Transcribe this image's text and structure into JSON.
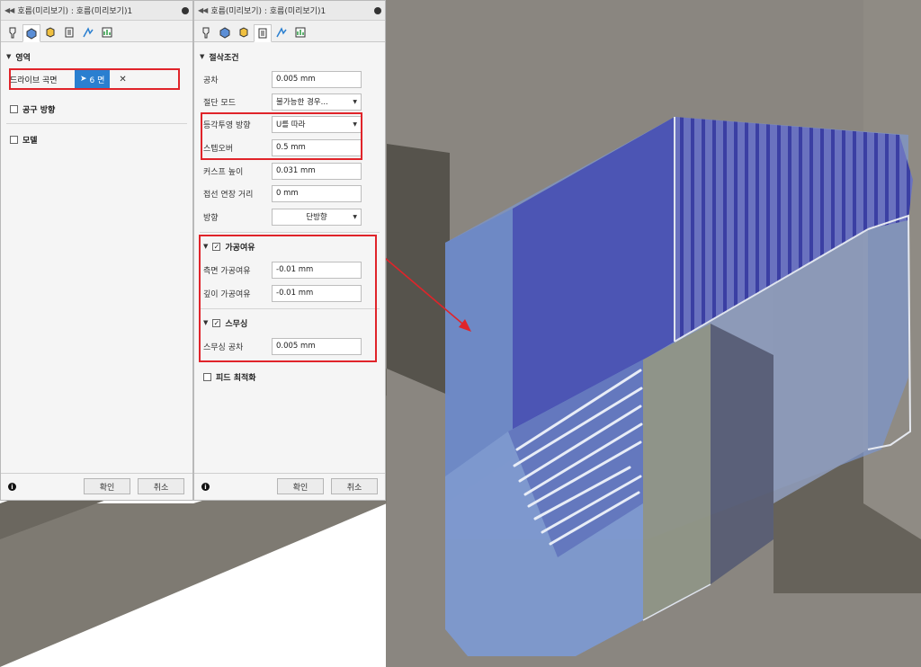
{
  "panel_left": {
    "title": "호름(미리보기) : 호름(미리보기)1",
    "section_region": "영역",
    "drive_surface_label": "드라이브 곡면",
    "face_count": "6 면",
    "clear_glyph": "✕",
    "tool_direction": "공구 방향",
    "model": "모델",
    "ok": "확인",
    "cancel": "취소"
  },
  "panel_right": {
    "title": "호름(미리보기) : 호름(미리보기)1",
    "section_cutting": "절삭조건",
    "tolerance_label": "공차",
    "tolerance_value": "0.005 mm",
    "cut_mode_label": "절단 모드",
    "cut_mode_value": "불가능한 경우...",
    "proj_dir_label": "등각투영 방향",
    "proj_dir_value": "U를 따라",
    "stepover_label": "스텝오버",
    "stepover_value": "0.5 mm",
    "cusp_label": "커스프 높이",
    "cusp_value": "0.031 mm",
    "tangent_label": "접선 연장 거리",
    "tangent_value": "0 mm",
    "direction_label": "방향",
    "direction_value": "단방향",
    "stock_section": "가공여유",
    "side_stock_label": "측면 가공여유",
    "side_stock_value": "-0.01 mm",
    "depth_stock_label": "깊이 가공여유",
    "depth_stock_value": "-0.01 mm",
    "smoothing_section": "스무싱",
    "smoothing_tol_label": "스무싱 공차",
    "smoothing_tol_value": "0.005 mm",
    "feed_opt": "피드 최적화",
    "ok": "확인",
    "cancel": "취소"
  },
  "icons": [
    "collapse-arrows-icon",
    "tool-tab-icon",
    "geometry-tab-icon",
    "heights-tab-icon",
    "passes-tab-icon",
    "linking-tab-icon",
    "checkbox-icon",
    "info-icon",
    "dropdown-caret-icon",
    "cursor-icon"
  ],
  "colors": {
    "highlight": "#e0242a",
    "accent": "#2a7fd0"
  }
}
